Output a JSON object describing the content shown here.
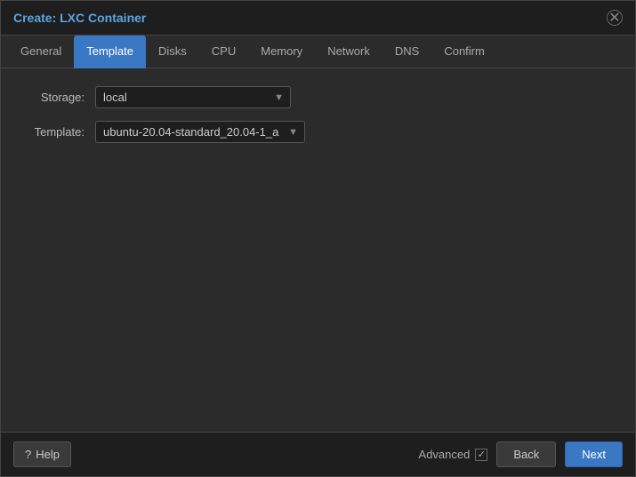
{
  "dialog": {
    "title": "Create: LXC Container"
  },
  "tabs": [
    {
      "label": "General",
      "active": false
    },
    {
      "label": "Template",
      "active": true
    },
    {
      "label": "Disks",
      "active": false
    },
    {
      "label": "CPU",
      "active": false
    },
    {
      "label": "Memory",
      "active": false
    },
    {
      "label": "Network",
      "active": false
    },
    {
      "label": "DNS",
      "active": false
    },
    {
      "label": "Confirm",
      "active": false
    }
  ],
  "form": {
    "storage_label": "Storage:",
    "storage_value": "local",
    "template_label": "Template:",
    "template_value": "ubuntu-20.04-standard_20.04-1_a"
  },
  "footer": {
    "help_label": "Help",
    "advanced_label": "Advanced",
    "back_label": "Back",
    "next_label": "Next"
  }
}
